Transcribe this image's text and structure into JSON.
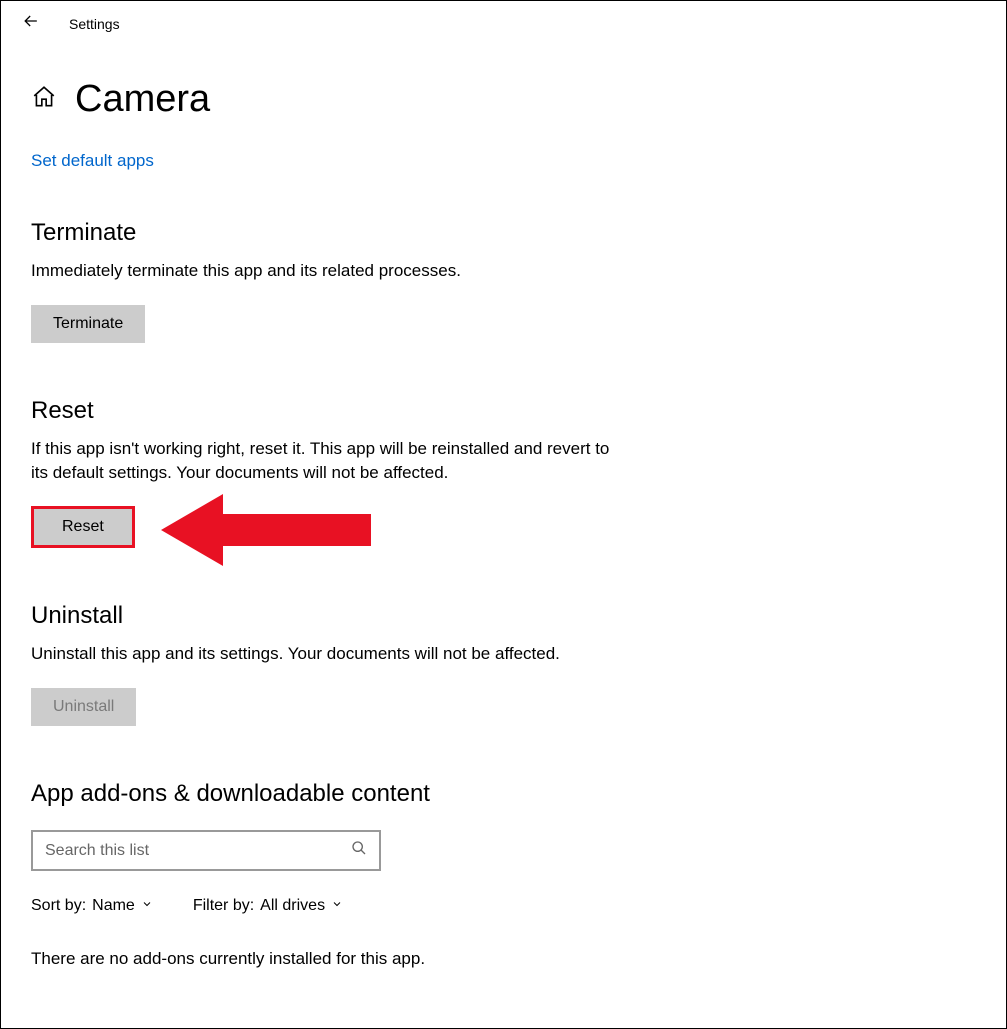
{
  "topbar": {
    "label": "Settings"
  },
  "page": {
    "title": "Camera"
  },
  "link": {
    "set_default": "Set default apps"
  },
  "terminate": {
    "heading": "Terminate",
    "desc": "Immediately terminate this app and its related processes.",
    "button": "Terminate"
  },
  "reset": {
    "heading": "Reset",
    "desc": "If this app isn't working right, reset it. This app will be reinstalled and revert to its default settings. Your documents will not be affected.",
    "button": "Reset"
  },
  "uninstall": {
    "heading": "Uninstall",
    "desc": "Uninstall this app and its settings. Your documents will not be affected.",
    "button": "Uninstall"
  },
  "addons": {
    "heading": "App add-ons & downloadable content",
    "search_placeholder": "Search this list",
    "sort_label": "Sort by:",
    "sort_value": "Name",
    "filter_label": "Filter by:",
    "filter_value": "All drives",
    "empty": "There are no add-ons currently installed for this app."
  },
  "annotation": {
    "arrow_color": "#e81123"
  }
}
